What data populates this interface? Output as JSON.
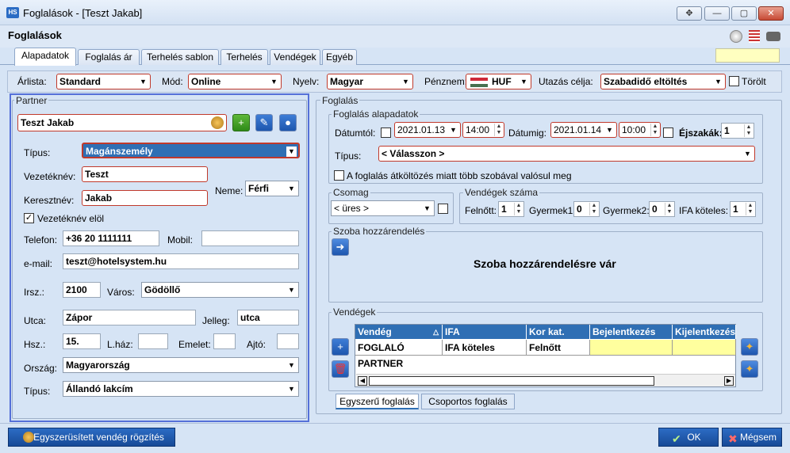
{
  "window": {
    "app_icon": "HS",
    "title": "Foglalások - [Teszt Jakab]",
    "buttons": [
      "✥",
      "—",
      "▢",
      "✕"
    ]
  },
  "header": {
    "title": "Foglalások"
  },
  "tabs": [
    "Alapadatok",
    "Foglalás ár",
    "Terhelés sablon",
    "Terhelés",
    "Vendégek",
    "Egyéb"
  ],
  "topbar": {
    "arlista_label": "Árlista:",
    "arlista_value": "Standard",
    "mod_label": "Mód:",
    "mod_value": "Online",
    "nyelv_label": "Nyelv:",
    "nyelv_value": "Magyar",
    "penznem_label": "Pénznem:",
    "penznem_value": "HUF",
    "utazas_label": "Utazás célja:",
    "utazas_value": "Szabadidő eltöltés",
    "torolt_label": "Törölt"
  },
  "partner": {
    "group_label": "Partner",
    "name": "Teszt Jakab",
    "tipus_label": "Típus:",
    "tipus_value": "Magánszemély",
    "vezeteknev_label": "Vezetéknév:",
    "vezeteknev_value": "Teszt",
    "keresztnev_label": "Keresztnév:",
    "keresztnev_value": "Jakab",
    "neme_label": "Neme:",
    "neme_value": "Férfi",
    "vezeteknev_elol_label": "Vezetéknév elöl",
    "telefon_label": "Telefon:",
    "telefon_value": "+36 20 1111111",
    "mobil_label": "Mobil:",
    "mobil_value": "",
    "email_label": "e-mail:",
    "email_value": "teszt@hotelsystem.hu",
    "irsz_label": "Irsz.:",
    "irsz_value": "2100",
    "varos_label": "Város:",
    "varos_value": "Gödöllő",
    "utca_label": "Utca:",
    "utca_value": "Zápor",
    "jelleg_label": "Jelleg:",
    "jelleg_value": "utca",
    "hsz_label": "Hsz.:",
    "hsz_value": "15.",
    "lhaz_label": "L.ház:",
    "emelet_label": "Emelet:",
    "ajto_label": "Ajtó:",
    "orszag_label": "Ország:",
    "orszag_value": "Magyarország",
    "cim_tipus_label": "Típus:",
    "cim_tipus_value": "Állandó lakcím"
  },
  "foglalas": {
    "group_label": "Foglalás",
    "alap_label": "Foglalás alapadatok",
    "datumtol_label": "Dátumtól:",
    "datumtol_date": "2021.01.13",
    "datumtol_time": "14:00",
    "datumig_label": "Dátumig:",
    "datumig_date": "2021.01.14",
    "datumig_time": "10:00",
    "ejszakak_label": "Éjszakák:",
    "ejszakak_value": "1",
    "tipus_label": "Típus:",
    "tipus_value": "< Válasszon >",
    "atkoltozes_label": "A foglalás átköltözés miatt több szobával valósul meg",
    "csomag_label": "Csomag",
    "csomag_value": "< üres >",
    "vendegek_szama_label": "Vendégek száma",
    "felnott_label": "Felnőtt:",
    "felnott_value": "1",
    "gyermek1_label": "Gyermek1:",
    "gyermek1_value": "0",
    "gyermek2_label": "Gyermek2:",
    "gyermek2_value": "0",
    "ifa_label": "IFA köteles:",
    "ifa_value": "1",
    "szoba_label": "Szoba hozzárendelés",
    "szoba_msg": "Szoba hozzárendelésre vár",
    "vendegek_label": "Vendégek",
    "columns": [
      "Vendég",
      "IFA",
      "Kor kat.",
      "Bejelentkezés",
      "Kijelentkezés"
    ],
    "rows": [
      [
        "FOGLALÓ PARTNER",
        "IFA köteles",
        "Felnőtt",
        "",
        ""
      ]
    ],
    "subtabs": [
      "Egyszerű foglalás",
      "Csoportos foglalás"
    ]
  },
  "bottom": {
    "quick_guest": "Egyszerüsített vendég rögzítés",
    "ok": "OK",
    "cancel": "Mégsem"
  }
}
